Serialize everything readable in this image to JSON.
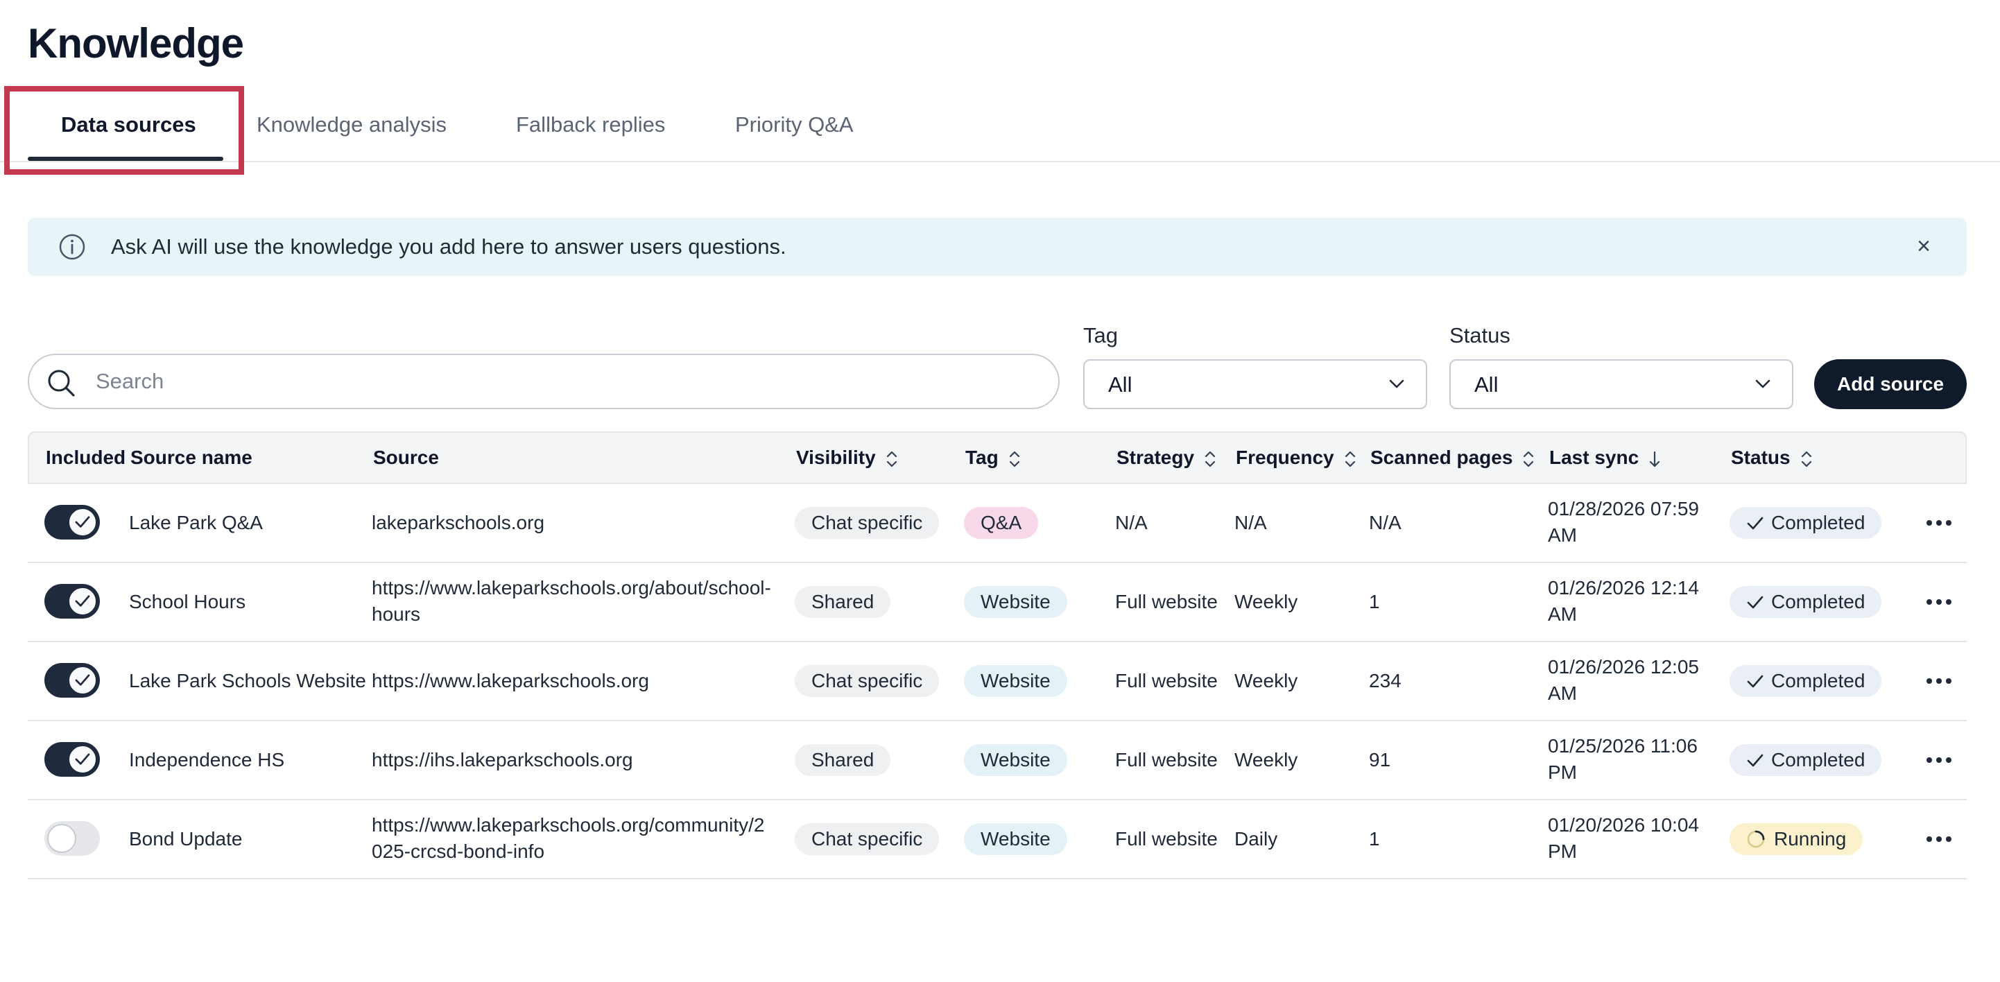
{
  "page": {
    "title": "Knowledge"
  },
  "tabs": [
    {
      "label": "Data sources",
      "active": true
    },
    {
      "label": "Knowledge analysis",
      "active": false
    },
    {
      "label": "Fallback replies",
      "active": false
    },
    {
      "label": "Priority Q&A",
      "active": false
    }
  ],
  "banner": {
    "text": "Ask AI will use the knowledge you add here to answer users questions.",
    "icon": "info-icon",
    "close_icon": "close-icon"
  },
  "search": {
    "placeholder": "Search",
    "value": ""
  },
  "filters": {
    "tag": {
      "label": "Tag",
      "value": "All"
    },
    "status": {
      "label": "Status",
      "value": "All"
    }
  },
  "add_source_label": "Add source",
  "table": {
    "headers": [
      "Included",
      "Source name",
      "Source",
      "Visibility",
      "Tag",
      "Strategy",
      "Frequency",
      "Scanned pages",
      "Last sync",
      "Status"
    ],
    "rows": [
      {
        "included": true,
        "name": "Lake Park Q&A",
        "source": [
          "lakeparkschools.org"
        ],
        "visibility": "Chat specific",
        "tag": "Q&A",
        "tag_color": "pink",
        "strategy": "N/A",
        "frequency": "N/A",
        "scanned": "N/A",
        "last_sync": [
          "01/28/2026 07:59",
          "AM"
        ],
        "status": "Completed"
      },
      {
        "included": true,
        "name": "School Hours",
        "source": [
          "https://www.lakeparkschools.org/about/school-",
          "hours"
        ],
        "visibility": "Shared",
        "tag": "Website",
        "tag_color": "blue",
        "strategy": "Full website",
        "frequency": "Weekly",
        "scanned": "1",
        "last_sync": [
          "01/26/2026 12:14",
          "AM"
        ],
        "status": "Completed"
      },
      {
        "included": true,
        "name": "Lake Park Schools Website",
        "source": [
          "https://www.lakeparkschools.org"
        ],
        "visibility": "Chat specific",
        "tag": "Website",
        "tag_color": "blue",
        "strategy": "Full website",
        "frequency": "Weekly",
        "scanned": "234",
        "last_sync": [
          "01/26/2026 12:05",
          "AM"
        ],
        "status": "Completed"
      },
      {
        "included": true,
        "name": "Independence HS",
        "source": [
          "https://ihs.lakeparkschools.org"
        ],
        "visibility": "Shared",
        "tag": "Website",
        "tag_color": "blue",
        "strategy": "Full website",
        "frequency": "Weekly",
        "scanned": "91",
        "last_sync": [
          "01/25/2026 11:06",
          "PM"
        ],
        "status": "Completed"
      },
      {
        "included": false,
        "name": "Bond Update",
        "source": [
          "https://www.lakeparkschools.org/community/2",
          "025-crcsd-bond-info"
        ],
        "visibility": "Chat specific",
        "tag": "Website",
        "tag_color": "blue",
        "strategy": "Full website",
        "frequency": "Daily",
        "scanned": "1",
        "last_sync": [
          "01/20/2026 10:04",
          "PM"
        ],
        "status": "Running"
      }
    ]
  }
}
